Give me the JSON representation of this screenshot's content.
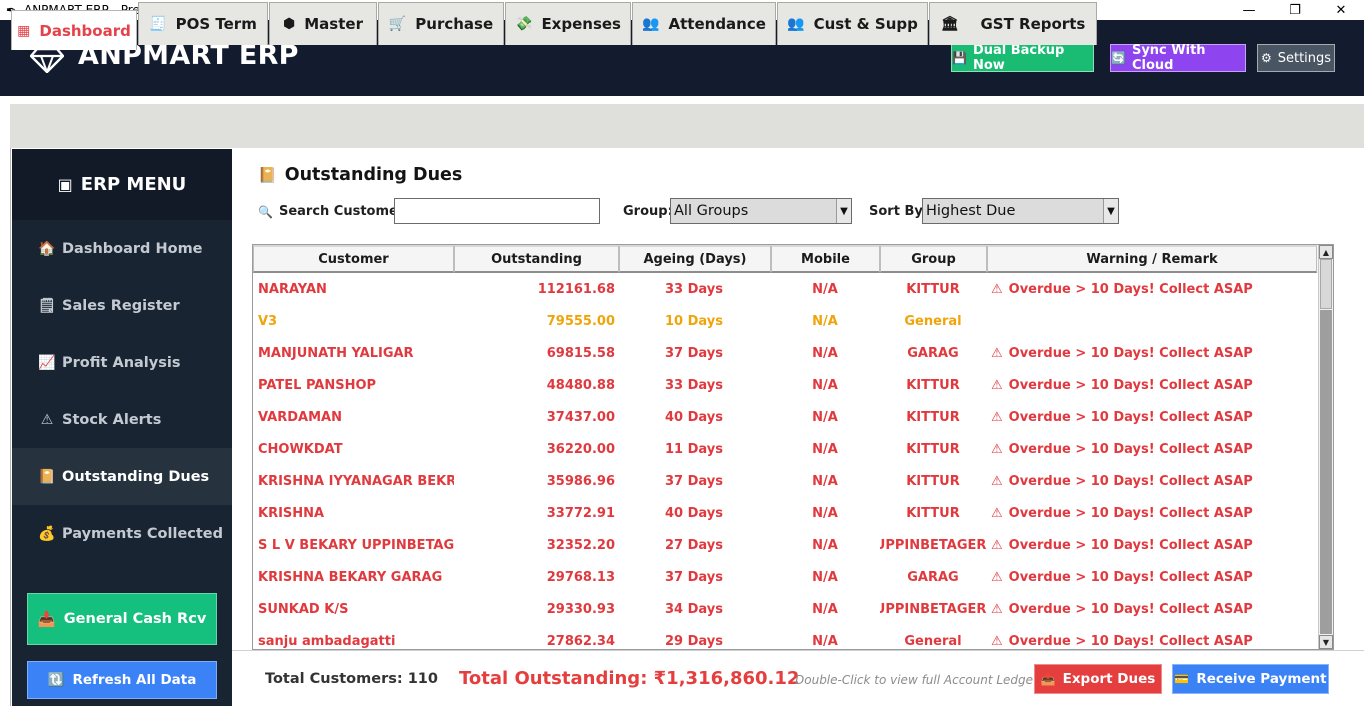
{
  "window": {
    "title": "ANPMART ERP - Premium Offline Edition",
    "controls": {
      "minimize": "—",
      "maximize": "❐",
      "close": "✕"
    }
  },
  "header": {
    "app_name": "ANPMART ERP",
    "buttons": {
      "backup": "Dual Backup Now",
      "sync": "Sync With Cloud",
      "settings": "Settings"
    }
  },
  "tabs": [
    {
      "label": "Dashboard",
      "icon": "dashboard-icon"
    },
    {
      "label": "POS Term",
      "icon": "receipt-icon"
    },
    {
      "label": "Master",
      "icon": "cube-icon"
    },
    {
      "label": "Purchase",
      "icon": "cart-icon"
    },
    {
      "label": "Expenses",
      "icon": "money-icon"
    },
    {
      "label": "Attendance",
      "icon": "users-icon"
    },
    {
      "label": "Cust & Supp",
      "icon": "users-icon"
    },
    {
      "label": "GST Reports",
      "icon": "bank-icon"
    }
  ],
  "sidebar": {
    "title": "ERP MENU",
    "items": [
      {
        "label": "Dashboard Home",
        "icon": "home-icon"
      },
      {
        "label": "Sales Register",
        "icon": "register-icon"
      },
      {
        "label": "Profit Analysis",
        "icon": "chart-icon"
      },
      {
        "label": "Stock Alerts",
        "icon": "warning-icon"
      },
      {
        "label": "Outstanding Dues",
        "icon": "book-icon"
      },
      {
        "label": "Payments Collected",
        "icon": "money-bag-icon"
      }
    ],
    "active_item": "Outstanding Dues",
    "buttons": {
      "cash": "General Cash Rcv",
      "refresh": "Refresh All Data"
    }
  },
  "main": {
    "title": "Outstanding Dues",
    "search": {
      "label": "Search Customer:",
      "value": "",
      "placeholder": ""
    },
    "group": {
      "label": "Group:",
      "selected": "All Groups"
    },
    "sort": {
      "label": "Sort By:",
      "selected": "Highest Due"
    }
  },
  "table": {
    "columns": [
      "Customer",
      "Outstanding",
      "Ageing (Days)",
      "Mobile",
      "Group",
      "Warning / Remark"
    ],
    "rows": [
      {
        "customer": "NARAYAN",
        "outstanding": "112161.68",
        "ageing": "33 Days",
        "mobile": "N/A",
        "group": "KITTUR",
        "remark": "Overdue > 10 Days! Collect ASAP",
        "level": "overdue"
      },
      {
        "customer": "V3",
        "outstanding": "79555.00",
        "ageing": "10 Days",
        "mobile": "N/A",
        "group": "General",
        "remark": "",
        "level": "warn"
      },
      {
        "customer": "MANJUNATH YALIGAR",
        "outstanding": "69815.58",
        "ageing": "37 Days",
        "mobile": "N/A",
        "group": "GARAG",
        "remark": "Overdue > 10 Days! Collect ASAP",
        "level": "overdue"
      },
      {
        "customer": "PATEL PANSHOP",
        "outstanding": "48480.88",
        "ageing": "33 Days",
        "mobile": "N/A",
        "group": "KITTUR",
        "remark": "Overdue > 10 Days! Collect ASAP",
        "level": "overdue"
      },
      {
        "customer": "VARDAMAN",
        "outstanding": "37437.00",
        "ageing": "40 Days",
        "mobile": "N/A",
        "group": "KITTUR",
        "remark": "Overdue > 10 Days! Collect ASAP",
        "level": "overdue"
      },
      {
        "customer": "CHOWKDAT",
        "outstanding": "36220.00",
        "ageing": "11 Days",
        "mobile": "N/A",
        "group": "KITTUR",
        "remark": "Overdue > 10 Days! Collect ASAP",
        "level": "overdue"
      },
      {
        "customer": "KRISHNA IYYANAGAR BEKRY CI",
        "outstanding": "35986.96",
        "ageing": "37 Days",
        "mobile": "N/A",
        "group": "KITTUR",
        "remark": "Overdue > 10 Days! Collect ASAP",
        "level": "overdue"
      },
      {
        "customer": "KRISHNA",
        "outstanding": "33772.91",
        "ageing": "40 Days",
        "mobile": "N/A",
        "group": "KITTUR",
        "remark": "Overdue > 10 Days! Collect ASAP",
        "level": "overdue"
      },
      {
        "customer": "S L V BEKARY UPPINBETAGERI",
        "outstanding": "32352.20",
        "ageing": "27 Days",
        "mobile": "N/A",
        "group": "UPPINBETAGERI",
        "remark": "Overdue > 10 Days! Collect ASAP",
        "level": "overdue"
      },
      {
        "customer": "KRISHNA BEKARY GARAG",
        "outstanding": "29768.13",
        "ageing": "37 Days",
        "mobile": "N/A",
        "group": "GARAG",
        "remark": "Overdue > 10 Days! Collect ASAP",
        "level": "overdue"
      },
      {
        "customer": "SUNKAD K/S",
        "outstanding": "29330.93",
        "ageing": "34 Days",
        "mobile": "N/A",
        "group": "UPPINBETAGERI",
        "remark": "Overdue > 10 Days! Collect ASAP",
        "level": "overdue"
      },
      {
        "customer": "sanju ambadagatti",
        "outstanding": "27862.34",
        "ageing": "29 Days",
        "mobile": "N/A",
        "group": "General",
        "remark": "Overdue > 10 Days! Collect ASAP",
        "level": "overdue"
      }
    ]
  },
  "footer": {
    "total_customers": "Total Customers: 110",
    "total_outstanding": "Total Outstanding: ₹1,316,860.12",
    "hint": "Double-Click to view full Account Ledge",
    "export": "Export Dues",
    "receive": "Receive Payment"
  },
  "colors": {
    "header_bg": "#131c2e",
    "sidebar_bg": "#192432",
    "accent_red": "#e53e3e",
    "warn_orange": "#efa50a",
    "green": "#1abc73",
    "purple": "#8e44ef",
    "blue": "#3b82f6"
  }
}
